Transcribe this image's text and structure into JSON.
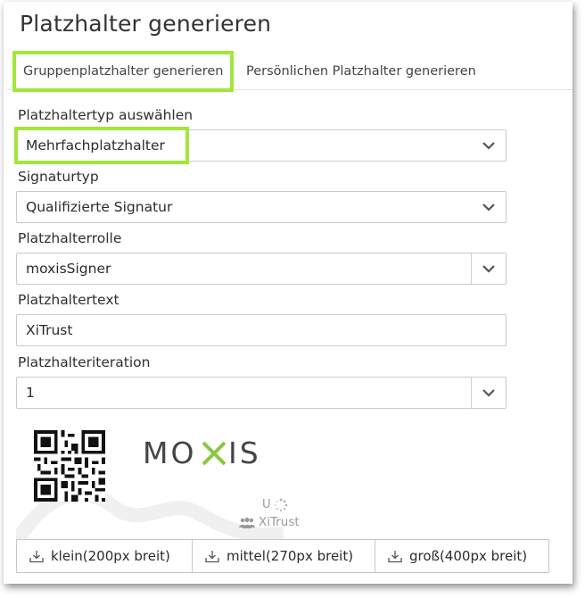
{
  "page": {
    "title": "Platzhalter generieren"
  },
  "tabs": [
    {
      "label": "Gruppenplatzhalter generieren",
      "active": true
    },
    {
      "label": "Persönlichen Platzhalter generieren",
      "active": false
    }
  ],
  "form": {
    "placeholder_type": {
      "label": "Platzhaltertyp auswählen",
      "value": "Mehrfachplatzhalter"
    },
    "signature_type": {
      "label": "Signaturtyp",
      "value": "Qualifizierte Signatur"
    },
    "placeholder_role": {
      "label": "Platzhalterrolle",
      "value": "moxisSigner"
    },
    "placeholder_text": {
      "label": "Platzhaltertext",
      "value": "XiTrust"
    },
    "placeholder_iteration": {
      "label": "Platzhalteriteration",
      "value": "1"
    }
  },
  "preview": {
    "logo_text": "MOXIS",
    "small_u": "U",
    "brand_text": "XiTrust"
  },
  "download_buttons": [
    {
      "label": "klein(200px breit)",
      "icon": "download-icon"
    },
    {
      "label": "mittel(270px breit)",
      "icon": "download-icon"
    },
    {
      "label": "groß(400px breit)",
      "icon": "download-icon"
    }
  ],
  "colors": {
    "highlight": "#a3e63a",
    "logo_accent": "#8cc63f",
    "text": "#2b2b2b"
  }
}
